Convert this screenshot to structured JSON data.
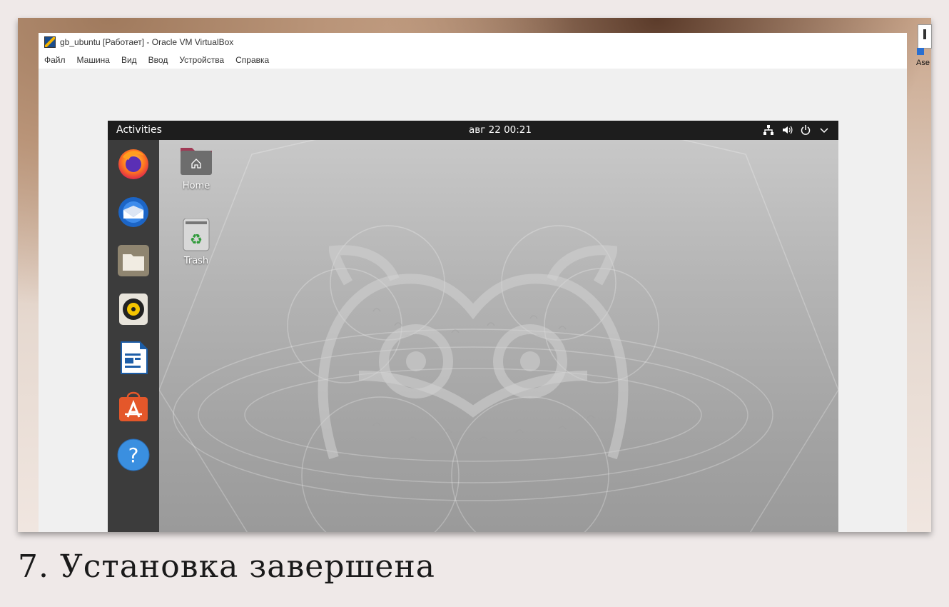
{
  "host": {
    "shortcut_label": "Ase"
  },
  "vbox": {
    "title": "gb_ubuntu [Работает] - Oracle VM VirtualBox",
    "menu": [
      "Файл",
      "Машина",
      "Вид",
      "Ввод",
      "Устройства",
      "Справка"
    ]
  },
  "ubuntu": {
    "topbar": {
      "activities": "Activities",
      "clock": "авг 22  00:21"
    },
    "dock": [
      {
        "name": "firefox-icon"
      },
      {
        "name": "thunderbird-icon"
      },
      {
        "name": "files-icon"
      },
      {
        "name": "rhythmbox-icon"
      },
      {
        "name": "libreoffice-writer-icon"
      },
      {
        "name": "software-center-icon"
      },
      {
        "name": "help-icon"
      }
    ],
    "desktop_icons": [
      {
        "label": "Home",
        "icon": "home-folder-icon"
      },
      {
        "label": "Trash",
        "icon": "trash-icon"
      }
    ]
  },
  "caption": "7. Установка завершена"
}
